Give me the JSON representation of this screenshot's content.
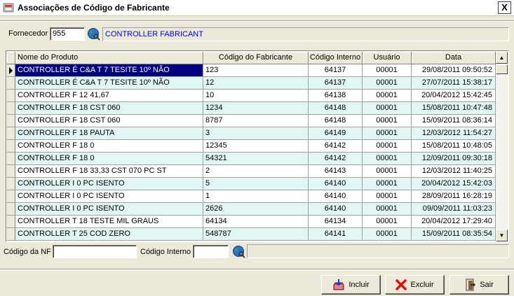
{
  "window": {
    "title": "Associações de Código de Fabricante",
    "close_label": "X"
  },
  "supplier": {
    "label": "Fornecedor",
    "code": "955",
    "name": "CONTROLLER FABRICANT"
  },
  "grid": {
    "columns": [
      "Nome do Produto",
      "Código do Fabricante",
      "Código Interno",
      "Usuário",
      "Data"
    ],
    "rows": [
      [
        "CONTROLLER É C&A T 7 TESITE 10º NÃO",
        "123",
        "64137",
        "00001",
        "29/08/2011 09:50:52"
      ],
      [
        "CONTROLLER É C&A T 7 TESITE 10º NÃO",
        "12",
        "64137",
        "00001",
        "27/07/2011 15:38:17"
      ],
      [
        "CONTROLLER F 12 41,67",
        "10",
        "64138",
        "00001",
        "20/04/2012 15:42:45"
      ],
      [
        "CONTROLLER F 18 CST 060",
        "1234",
        "64148",
        "00001",
        "15/08/2011 10:47:48"
      ],
      [
        "CONTROLLER F 18 CST 060",
        "8787",
        "64148",
        "00001",
        "15/09/2011 08:36:14"
      ],
      [
        "CONTROLLER F 18 PAUTA",
        "3",
        "64149",
        "00001",
        "12/03/2012 11:54:27"
      ],
      [
        "CONTROLLER F 18 0",
        "12345",
        "64142",
        "00001",
        "15/08/2011 10:48:05"
      ],
      [
        "CONTROLLER F 18 0",
        "54321",
        "64142",
        "00001",
        "12/09/2011 09:30:18"
      ],
      [
        "CONTROLLER F 18 33,33 CST 070 PC ST",
        "2",
        "64143",
        "00001",
        "12/03/2012 11:40:25"
      ],
      [
        "CONTROLLER I 0   PC ISENTO",
        "5",
        "64140",
        "00001",
        "20/04/2012 15:42:03"
      ],
      [
        "CONTROLLER I 0   PC ISENTO",
        "1",
        "64140",
        "00001",
        "28/09/2011 16:28:19"
      ],
      [
        "CONTROLLER I 0   PC ISENTO",
        "2626",
        "64140",
        "00001",
        "09/09/2011 11:03:23"
      ],
      [
        "CONTROLLER T 18  TESTE MIL GRAUS",
        "64134",
        "64134",
        "00001",
        "20/04/2012 17:29:40"
      ],
      [
        "CONTROLLER T 25 COD ZERO",
        "548787",
        "64141",
        "00001",
        "15/09/2011 08:35:54"
      ]
    ],
    "selected_row": 0
  },
  "search": {
    "nf_label": "Código da NF",
    "nf_value": "",
    "internal_label": "Código Interno",
    "internal_value": ""
  },
  "buttons": {
    "include": "Incluir",
    "delete": "Excluir",
    "exit": "Sair"
  },
  "colors": {
    "selection": "#000080",
    "alt_row": "#e0f7f3",
    "link_text": "#0000ff",
    "window_bg": "#ece9d8"
  },
  "icons": [
    "app-icon",
    "close-icon",
    "globe-search-icon",
    "scroll-up-icon",
    "scroll-down-icon",
    "row-indicator-icon",
    "include-icon",
    "delete-icon",
    "exit-icon"
  ]
}
